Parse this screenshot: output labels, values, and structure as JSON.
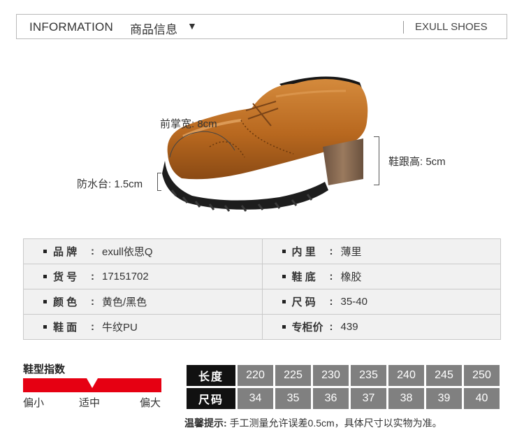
{
  "header": {
    "title": "INFORMATION",
    "title_cn": "商品信息",
    "arrow": "▼",
    "brand": "EXULL SHOES"
  },
  "annotations": {
    "forefoot": "前掌宽: 8cm",
    "platform": "防水台: 1.5cm",
    "heel": "鞋跟高: 5cm"
  },
  "colors": {
    "shoe_leather": "#b8681f",
    "sole": "#1d1d1d",
    "heel_wood": "#8a6a50",
    "accent_red": "#e60012",
    "size_cell": "#808080"
  },
  "specs": [
    [
      {
        "label": "品 牌",
        "value": "exull依思Q"
      },
      {
        "label": "内 里",
        "value": "薄里"
      }
    ],
    [
      {
        "label": "货 号",
        "value": "17151702"
      },
      {
        "label": "鞋 底",
        "value": "橡胶"
      }
    ],
    [
      {
        "label": "颜 色",
        "value": "黄色/黑色"
      },
      {
        "label": "尺 码",
        "value": "35-40"
      }
    ],
    [
      {
        "label": "鞋 面",
        "value": "牛纹PU"
      },
      {
        "label": "专柜价",
        "value": "439"
      }
    ]
  ],
  "fit": {
    "title": "鞋型指数",
    "marker": "▼",
    "labels": [
      "偏小",
      "适中",
      "偏大"
    ],
    "level": 0.5
  },
  "size_table": {
    "length_label": "长度",
    "size_label": "尺码",
    "lengths": [
      "220",
      "225",
      "230",
      "235",
      "240",
      "245",
      "250"
    ],
    "sizes": [
      "34",
      "35",
      "36",
      "37",
      "38",
      "39",
      "40"
    ]
  },
  "tip": {
    "label": "温馨提示:",
    "text": "手工测量允许误差0.5cm，具体尺寸以实物为准。"
  }
}
